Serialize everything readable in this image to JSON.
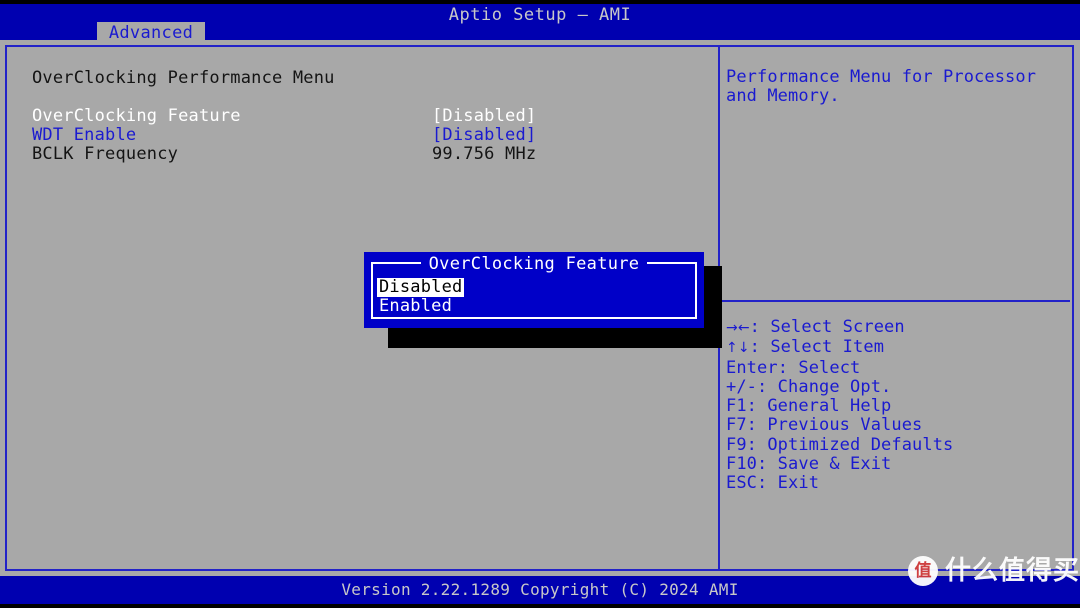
{
  "header": {
    "app_title": "Aptio Setup – AMI",
    "tab_label": "Advanced"
  },
  "left_panel": {
    "section_title": "OverClocking Performance Menu",
    "options": [
      {
        "label": "OverClocking Feature",
        "value": "[Disabled]",
        "color": "#ffffff",
        "state": "selected"
      },
      {
        "label": "WDT Enable",
        "value": "[Disabled]",
        "color": "#1a1ad0",
        "state": "normal"
      },
      {
        "label": "BCLK Frequency",
        "value": "99.756 MHz",
        "color": "#141414",
        "state": "normal"
      }
    ]
  },
  "right_panel": {
    "help_text": "Performance Menu for Processor and Memory.",
    "key_bindings": [
      {
        "glyph": "→←",
        "keys": "",
        "text": ": Select Screen"
      },
      {
        "glyph": "↑↓",
        "keys": "",
        "text": ": Select Item"
      },
      {
        "glyph": "",
        "keys": "Enter",
        "text": ": Select"
      },
      {
        "glyph": "",
        "keys": "+/-",
        "text": ": Change Opt."
      },
      {
        "glyph": "",
        "keys": "F1",
        "text": ": General Help"
      },
      {
        "glyph": "",
        "keys": "F7",
        "text": ": Previous Values"
      },
      {
        "glyph": "",
        "keys": "F9",
        "text": ": Optimized Defaults"
      },
      {
        "glyph": "",
        "keys": "F10",
        "text": ": Save & Exit"
      },
      {
        "glyph": "",
        "keys": "ESC",
        "text": ": Exit"
      }
    ]
  },
  "dialog": {
    "title": "OverClocking Feature",
    "options": [
      {
        "label": "Disabled",
        "selected": true
      },
      {
        "label": "Enabled",
        "selected": false
      }
    ]
  },
  "footer": {
    "version_text": "Version 2.22.1289 Copyright (C) 2024 AMI"
  },
  "watermark": {
    "logo_char": "值",
    "text": "什么值得买"
  },
  "colors": {
    "background_blue": "#0000b0",
    "panel_gray": "#a8a8a8",
    "accent_blue": "#1a1ad0",
    "dialog_blue": "#0000c8",
    "highlight_white": "#ffffff",
    "title_gray": "#c8c8c8"
  }
}
